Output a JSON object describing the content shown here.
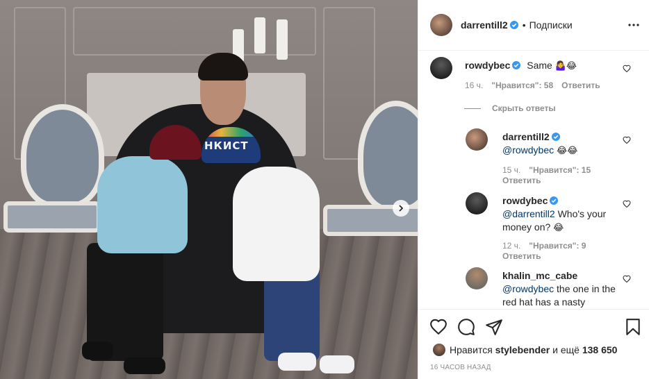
{
  "post": {
    "author": "darrentill2",
    "separator": "•",
    "follow_label": "Подписки",
    "more_icon": "more-horizontal-icon",
    "next_icon": "chevron-right-icon",
    "media_hat_text": "НКИСТ"
  },
  "comments": [
    {
      "user": "rowdybec",
      "text": "Same",
      "emoji": "🤷‍♀️😂",
      "time": "16 ч.",
      "likes": "\"Нравится\": 58",
      "reply": "Ответить"
    }
  ],
  "hide_replies": "Скрыть ответы",
  "replies": [
    {
      "user": "darrentill2",
      "mention": "@rowdybec",
      "text": "",
      "emoji": "😂😂",
      "time": "15 ч.",
      "likes": "\"Нравится\": 15",
      "reply": "Ответить"
    },
    {
      "user": "rowdybec",
      "mention": "@darrentill2",
      "text": " Who's your money on?",
      "emoji": "😂",
      "time": "12 ч.",
      "likes": "\"Нравится\": 9",
      "reply": "Ответить"
    },
    {
      "user": "khalin_mc_cabe",
      "mention": "@rowdybec",
      "text": " the one in the red hat has a nasty"
    }
  ],
  "actions": {
    "like_icon": "heart-icon",
    "comment_icon": "comment-icon",
    "share_icon": "share-icon",
    "save_icon": "bookmark-icon"
  },
  "likes": {
    "prefix": "Нравится",
    "user": "stylebender",
    "and_more": "и ещё",
    "count": "138 650"
  },
  "time_ago": "16 часов назад",
  "colors": {
    "verified": "#3897f0",
    "text": "#262626",
    "muted": "#8e8e8e",
    "mention": "#00376b"
  }
}
